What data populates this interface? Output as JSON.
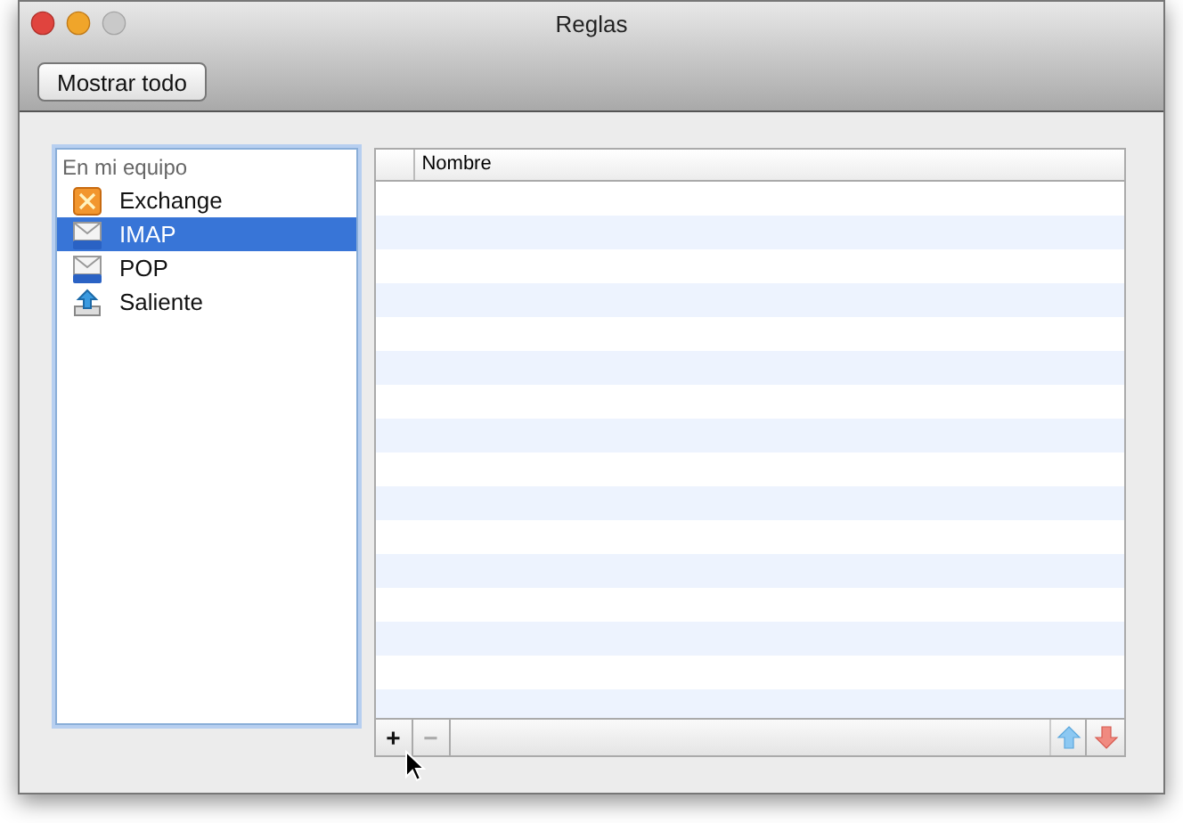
{
  "window": {
    "title": "Reglas"
  },
  "toolbar": {
    "button": "Mostrar todo"
  },
  "sidebar": {
    "header": "En mi equipo",
    "items": [
      {
        "label": "Exchange",
        "kind": "exchange",
        "selected": false
      },
      {
        "label": "IMAP",
        "kind": "imap",
        "selected": true
      },
      {
        "label": "POP",
        "kind": "pop",
        "selected": false
      },
      {
        "label": "Saliente",
        "kind": "outgoing",
        "selected": false
      }
    ]
  },
  "table": {
    "columns": [
      "Nombre"
    ]
  },
  "bottom_bar": {
    "buttons": [
      {
        "kind": "add",
        "label": "+",
        "disabled": false
      },
      {
        "kind": "remove",
        "label": "−",
        "disabled": true
      },
      {
        "kind": "up",
        "disabled": false
      },
      {
        "kind": "down",
        "disabled": false
      }
    ]
  }
}
